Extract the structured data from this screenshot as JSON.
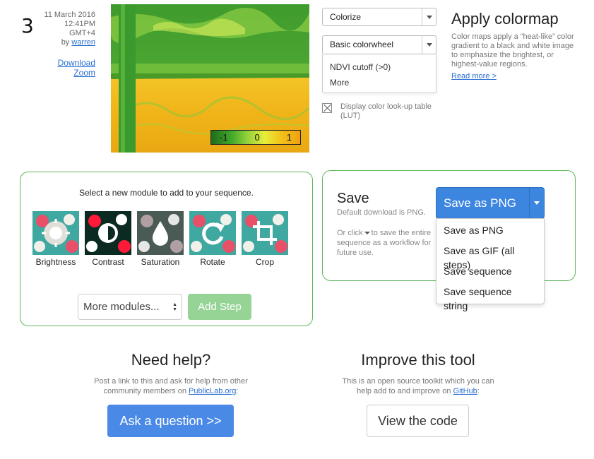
{
  "step": {
    "number": "3",
    "date": "11 March 2016",
    "time": "12:41PM",
    "timezone": "GMT+4",
    "by_label": "by",
    "author": "warren",
    "download_label": "Download",
    "zoom_label": "Zoom"
  },
  "image": {
    "lut_labels": [
      "-1",
      "0",
      "1"
    ]
  },
  "controls": {
    "mode_select": "Colorize",
    "colormap_select": "Basic colorwheel",
    "colormap_options": [
      "NDVI cutoff (>0)",
      "More"
    ],
    "lut_checkbox_label": "Display color look-up table (LUT)"
  },
  "description": {
    "title": "Apply colormap",
    "text": "Color maps apply a “heat-like” color gradient to a black and white image to emphasize the brightest, or highest-value regions.",
    "read_more": "Read more >"
  },
  "modules": {
    "title": "Select a new module to add to your sequence.",
    "items": [
      {
        "label": "Brightness",
        "icon": "sun-icon"
      },
      {
        "label": "Contrast",
        "icon": "contrast-icon"
      },
      {
        "label": "Saturation",
        "icon": "drop-icon"
      },
      {
        "label": "Rotate",
        "icon": "rotate-icon"
      },
      {
        "label": "Crop",
        "icon": "crop-icon"
      }
    ],
    "more_select": "More modules...",
    "add_step": "Add Step"
  },
  "save": {
    "title": "Save",
    "subtitle": "Default download is PNG.",
    "or_click": "Or click",
    "or_click_rest": "to save the entire sequence as a workflow for future use.",
    "button_label": "Save as PNG",
    "menu": [
      "Save as PNG",
      "Save as GIF (all steps)",
      "Save sequence",
      "Save sequence string"
    ]
  },
  "help": {
    "title": "Need help?",
    "text": "Post a link to this and ask for help from other community members on",
    "link": "PublicLab.org",
    "suffix": ":",
    "button": "Ask a question >>"
  },
  "improve": {
    "title": "Improve this tool",
    "text": "This is an open source toolkit which you can help add to and improve on",
    "link": "GitHub",
    "suffix": ":",
    "button": "View the code"
  },
  "colors": {
    "accent_blue": "#3d86e0",
    "panel_green": "#5cb85c",
    "add_step_green": "#95d495"
  }
}
